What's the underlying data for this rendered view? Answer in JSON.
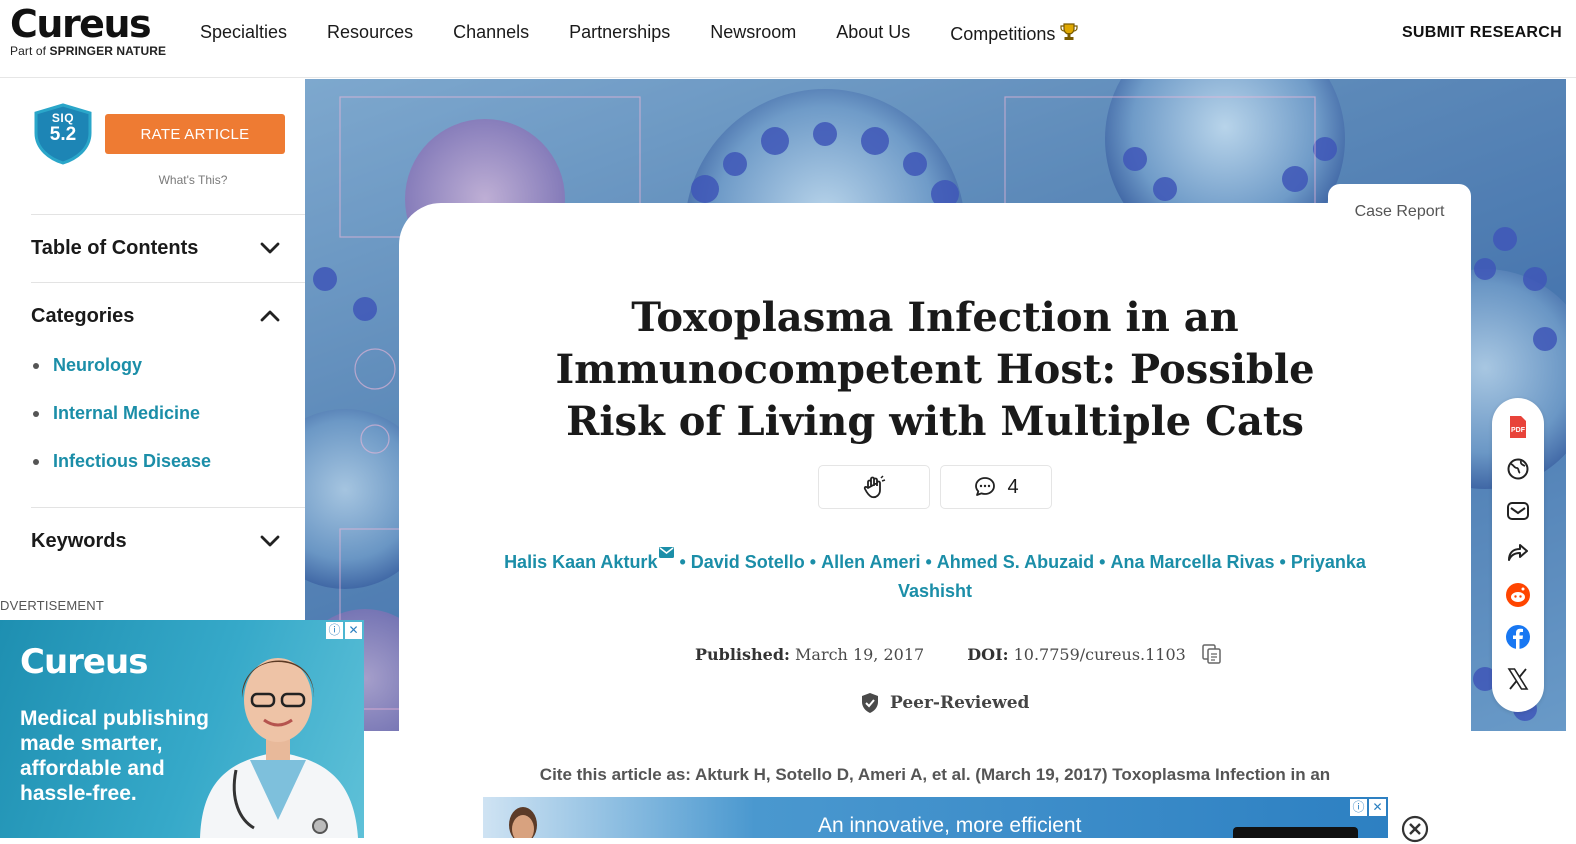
{
  "header": {
    "logo": "Cureus",
    "logo_sub_prefix": "Part of",
    "logo_sub_brand": "SPRINGER NATURE",
    "nav": [
      "Specialties",
      "Resources",
      "Channels",
      "Partnerships",
      "Newsroom",
      "About Us",
      "Competitions"
    ],
    "submit": "SUBMIT RESEARCH"
  },
  "sidebar": {
    "siq_label": "SIQ",
    "siq_value": "5.2",
    "rate_button": "RATE ARTICLE",
    "whats_this": "What's This?",
    "toc_title": "Table of Contents",
    "categories_title": "Categories",
    "categories": [
      "Neurology",
      "Internal Medicine",
      "Infectious Disease"
    ],
    "keywords_title": "Keywords"
  },
  "ad_left": {
    "label": "DVERTISEMENT",
    "logo": "Cureus",
    "copy": "Medical publishing made smarter, affordable and hassle-free."
  },
  "article": {
    "type_tab": "Case Report",
    "title": "Toxoplasma Infection in an Immunocompetent Host: Possible Risk of Living with Multiple Cats",
    "comment_count": "4",
    "authors": [
      "Halis Kaan Akturk",
      "David Sotello",
      "Allen Ameri",
      "Ahmed S. Abuzaid",
      "Ana Marcella Rivas",
      "Priyanka Vashisht"
    ],
    "published_label": "Published:",
    "published_date": "March 19, 2017",
    "doi_label": "DOI:",
    "doi_value": "10.7759/cureus.1103",
    "peer_reviewed": "Peer-Reviewed",
    "cite": "Cite this article as: Akturk H, Sotello D, Ameri A, et al. (March 19, 2017) Toxoplasma Infection in an"
  },
  "share_rail": [
    "pdf-icon",
    "globe-icon",
    "email-icon",
    "share-icon",
    "reddit-icon",
    "facebook-icon",
    "x-icon"
  ],
  "ad_bottom": {
    "text": "An innovative, more efficient"
  },
  "colors": {
    "accent_teal": "#1b8ea8",
    "rate_orange": "#ee7b33",
    "siq_blue": "#1d85b5"
  }
}
